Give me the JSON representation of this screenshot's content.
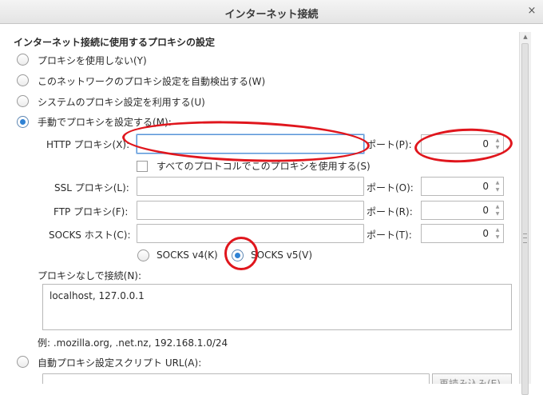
{
  "window": {
    "title": "インターネット接続",
    "close_glyph": "×"
  },
  "section_title": "インターネット接続に使用するプロキシの設定",
  "proxy_modes": [
    {
      "label": "プロキシを使用しない(Y)",
      "selected": false
    },
    {
      "label": "このネットワークのプロキシ設定を自動検出する(W)",
      "selected": false
    },
    {
      "label": "システムのプロキシ設定を利用する(U)",
      "selected": false
    },
    {
      "label": "手動でプロキシを設定する(M):",
      "selected": true
    }
  ],
  "http": {
    "label": "HTTP プロキシ(X):",
    "value": "",
    "port_label": "ポート(P):",
    "port": "0"
  },
  "all_protocols_label": "すべてのプロトコルでこのプロキシを使用する(S)",
  "ssl": {
    "label": "SSL プロキシ(L):",
    "value": "",
    "port_label": "ポート(O):",
    "port": "0"
  },
  "ftp": {
    "label": "FTP プロキシ(F):",
    "value": "",
    "port_label": "ポート(R):",
    "port": "0"
  },
  "socks": {
    "label": "SOCKS ホスト(C):",
    "value": "",
    "port_label": "ポート(T):",
    "port": "0"
  },
  "socks_versions": [
    {
      "label": "SOCKS v4(K)",
      "selected": false
    },
    {
      "label": "SOCKS v5(V)",
      "selected": true
    }
  ],
  "no_proxy": {
    "label": "プロキシなしで接続(N):",
    "value": "localhost, 127.0.0.1",
    "example": "例: .mozilla.org, .net.nz, 192.168.1.0/24"
  },
  "auto_config": {
    "label": "自動プロキシ設定スクリプト URL(A):",
    "selected": false,
    "reload_label": "再読み込み(E)"
  },
  "colors": {
    "annotation": "#e0161d",
    "accent": "#2f82d4"
  }
}
